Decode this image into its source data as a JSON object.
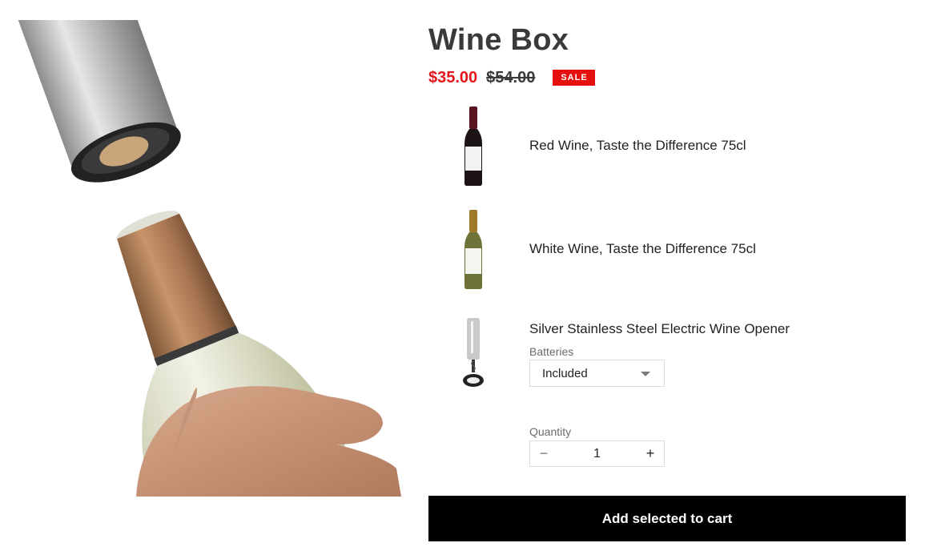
{
  "product": {
    "title": "Wine Box",
    "sale_price": "$35.00",
    "compare_price": "$54.00",
    "badge": "SALE"
  },
  "items": [
    {
      "name": "Red Wine, Taste the Difference 75cl",
      "icon": "red-wine-bottle-icon"
    },
    {
      "name": "White Wine, Taste the Difference 75cl",
      "icon": "white-wine-bottle-icon"
    },
    {
      "name": "Silver Stainless Steel Electric Wine Opener",
      "icon": "electric-wine-opener-icon"
    }
  ],
  "options": {
    "batteries": {
      "label": "Batteries",
      "selected": "Included"
    }
  },
  "quantity": {
    "label": "Quantity",
    "value": "1",
    "minus": "−",
    "plus": "+"
  },
  "cart": {
    "button_label": "Add selected to cart"
  },
  "colors": {
    "sale_red": "#e4161b",
    "badge_red": "#e60f0f",
    "button_black": "#000000"
  }
}
